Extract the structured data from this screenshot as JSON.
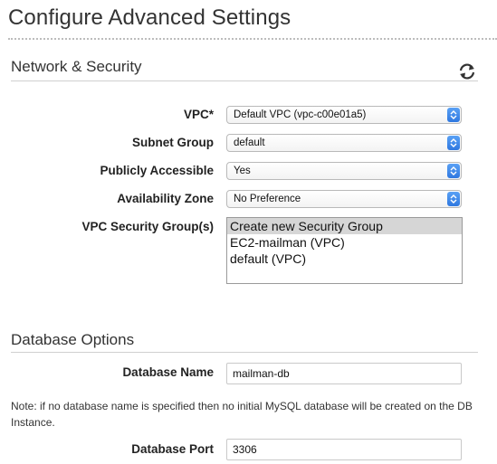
{
  "page": {
    "title": "Configure Advanced Settings"
  },
  "network_security": {
    "title": "Network & Security",
    "refresh_icon": "refresh-icon",
    "vpc": {
      "label": "VPC*",
      "value": "Default VPC (vpc-c00e01a5)"
    },
    "subnet_group": {
      "label": "Subnet Group",
      "value": "default"
    },
    "publicly_accessible": {
      "label": "Publicly Accessible",
      "value": "Yes"
    },
    "availability_zone": {
      "label": "Availability Zone",
      "value": "No Preference"
    },
    "security_groups": {
      "label": "VPC Security Group(s)",
      "options": [
        {
          "label": "Create new Security Group",
          "selected": true
        },
        {
          "label": "EC2-mailman (VPC)",
          "selected": false
        },
        {
          "label": "default (VPC)",
          "selected": false
        }
      ]
    }
  },
  "database_options": {
    "title": "Database Options",
    "database_name": {
      "label": "Database Name",
      "value": "mailman-db"
    },
    "note": "Note: if no database name is specified then no initial MySQL database will be created on the DB Instance.",
    "database_port": {
      "label": "Database Port",
      "value": "3306"
    }
  },
  "colors": {
    "stepper_blue": "#3b82e8",
    "selected_option": "#d6d6d6"
  }
}
